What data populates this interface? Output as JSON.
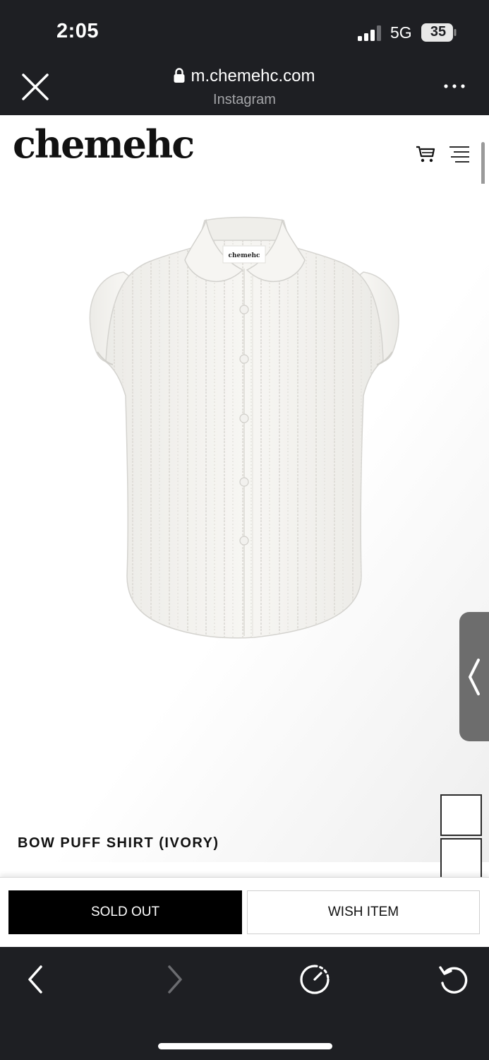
{
  "status_bar": {
    "time": "2:05",
    "network": "5G",
    "battery_level": "35"
  },
  "browser": {
    "url": "m.chemehc.com",
    "source": "Instagram",
    "close_icon": "close-icon",
    "more_icon": "more-icon",
    "lock_icon": "lock-icon"
  },
  "site": {
    "logo": "chemehc",
    "cart_icon": "cart-icon",
    "menu_icon": "menu-icon"
  },
  "product": {
    "name": "BOW PUFF SHIRT (IVORY)",
    "label_text": "chemehc",
    "image_description_icon": "shirt-image",
    "side_tab_icon": "chevron-left-icon"
  },
  "actions": {
    "sold_out": "SOLD OUT",
    "wish_item": "WISH ITEM"
  },
  "toolbar": {
    "back_icon": "chevron-left-icon",
    "forward_icon": "chevron-right-icon",
    "speed_icon": "speed-dial-icon",
    "reload_icon": "reload-icon"
  },
  "colors": {
    "chrome_dark": "#1e1f23",
    "sold_out_bg": "#000000",
    "side_tab": "#6d6d6d"
  }
}
